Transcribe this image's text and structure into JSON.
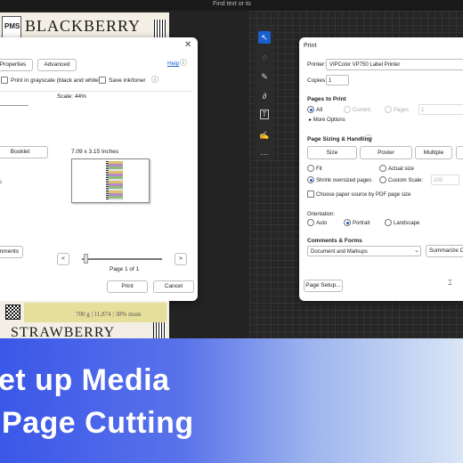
{
  "top_bar": {
    "search_placeholder": "Find text or to"
  },
  "labels": {
    "top": {
      "brand": "BLACKBERRY",
      "side": "PMS"
    },
    "bottom": {
      "price_line": "700 g | 11,874 | 38% mum",
      "brand": "STRAWBERRY"
    }
  },
  "left_dialog": {
    "tabs": {
      "properties": "Properties",
      "advanced": "Advanced"
    },
    "help": "Help",
    "print_grayscale": "Print in grayscale (black and white)",
    "save_ink": "Save ink/toner",
    "scale": "Scale: 44%",
    "page_size": "7.09 x 3.15 Inches",
    "booklet": "Booklet",
    "percent_fragment": "%",
    "comments_button": "mments",
    "page_indicator": "Page 1 of 1",
    "prev": "<",
    "next": ">",
    "print_button": "Print",
    "cancel_button": "Cancel"
  },
  "toolbar": {
    "icons": [
      "select-cursor-icon",
      "comment-icon",
      "pen-icon",
      "lasso-icon",
      "text-box-icon",
      "signature-icon",
      "more-icon"
    ]
  },
  "print_dialog": {
    "title": "Print",
    "printer_label": "Printer:",
    "printer_value": "VIPColor VP750 Label Printer",
    "copies_label": "Copies:",
    "copies_value": "1",
    "pages_to_print": "Pages to Print",
    "all": "All",
    "current": "Current",
    "pages": "Pages",
    "pages_value": "1",
    "more_options": "More Options",
    "sizing_heading": "Page Sizing & Handling",
    "sizing_buttons": [
      "Size",
      "Poster",
      "Multiple"
    ],
    "fit": "Fit",
    "actual_size": "Actual size",
    "shrink": "Shrink oversized pages",
    "custom_scale": "Custom Scale:",
    "custom_scale_value": "100",
    "choose_source": "Choose paper source by PDF page size",
    "orientation_heading": "Orientation:",
    "auto": "Auto",
    "portrait": "Portrait",
    "landscape": "Landscape",
    "comments_heading": "Comments & Forms",
    "comments_value": "Document and Markups",
    "summarize": "Summarize Co",
    "page_setup": "Page Setup..."
  },
  "banner": {
    "line1": "et up Media",
    "line2": " Page Cutting"
  },
  "colors": {
    "accent": "#1a5fd0",
    "banner_start": "#3a57e8",
    "banner_end": "#d9e5f6"
  }
}
